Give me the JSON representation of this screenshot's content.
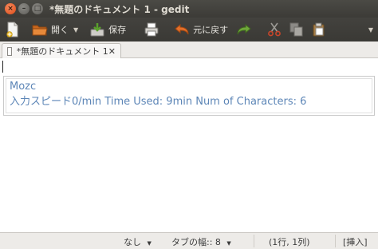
{
  "window": {
    "title": "*無題のドキュメント 1 - gedit"
  },
  "toolbar": {
    "open_label": "開く",
    "save_label": "保存",
    "undo_label": "元に戻す"
  },
  "tab": {
    "label": "*無題のドキュメント 1",
    "close": "✕"
  },
  "mozc": {
    "title": "Mozc",
    "stats": "入力スピード0/min  Time Used: 9min Num of Characters: 6"
  },
  "statusbar": {
    "syntax": "なし",
    "tab_width": "タブの幅:: 8",
    "position": "(1行, 1列)",
    "mode": "[挿入]"
  },
  "icons": {
    "new": "new-document-icon",
    "open": "open-folder-icon",
    "save": "save-icon",
    "print": "print-icon",
    "undo": "undo-icon",
    "redo": "redo-icon",
    "cut": "cut-icon",
    "copy": "copy-icon",
    "paste": "paste-icon"
  }
}
